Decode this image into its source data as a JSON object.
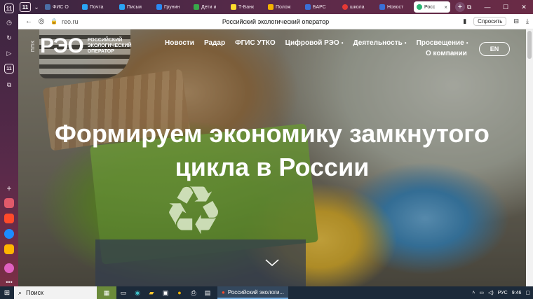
{
  "sidebar": {
    "tab_count": "11"
  },
  "tabs": {
    "count": "11",
    "items": [
      {
        "label": "ФИС О",
        "color": "#4a6fa5"
      },
      {
        "label": "Почта",
        "color": "#2aa4f4"
      },
      {
        "label": "Письм",
        "color": "#2aa4f4"
      },
      {
        "label": "Грунин",
        "color": "#2a8af4"
      },
      {
        "label": "Дети и",
        "color": "#38a84a"
      },
      {
        "label": "Т-Банк",
        "color": "#ffdd2d"
      },
      {
        "label": "Полож",
        "color": "#f4b400"
      },
      {
        "label": "БАРС",
        "color": "#3a6fd8"
      },
      {
        "label": "школа",
        "color": "#e53935"
      },
      {
        "label": "Новост",
        "color": "#3a6fd8"
      },
      {
        "label": "Росс",
        "color": "#2bb673",
        "active": true
      }
    ]
  },
  "addressbar": {
    "url": "reo.ru",
    "title": "Российский экологический оператор",
    "ask_label": "Спросить"
  },
  "site": {
    "logo_ppk": "ППК",
    "logo_main": "РЭО",
    "logo_sub": "Российский экологический оператор",
    "nav": [
      {
        "label": "Новости",
        "dropdown": false
      },
      {
        "label": "Радар",
        "dropdown": false
      },
      {
        "label": "ФГИС УТКО",
        "dropdown": false
      },
      {
        "label": "Цифровой РЭО",
        "dropdown": true
      },
      {
        "label": "Деятельность",
        "dropdown": true
      },
      {
        "label": "Просвещение",
        "dropdown": true
      }
    ],
    "nav_second_row": "О компании",
    "lang_button": "EN",
    "hero_line1": "Формируем экономику замкнутого",
    "hero_line2": "цикла в России"
  },
  "taskbar": {
    "search_placeholder": "Поиск",
    "active_app": "Российский экологи...",
    "lang": "РУС",
    "time": "9:46"
  }
}
